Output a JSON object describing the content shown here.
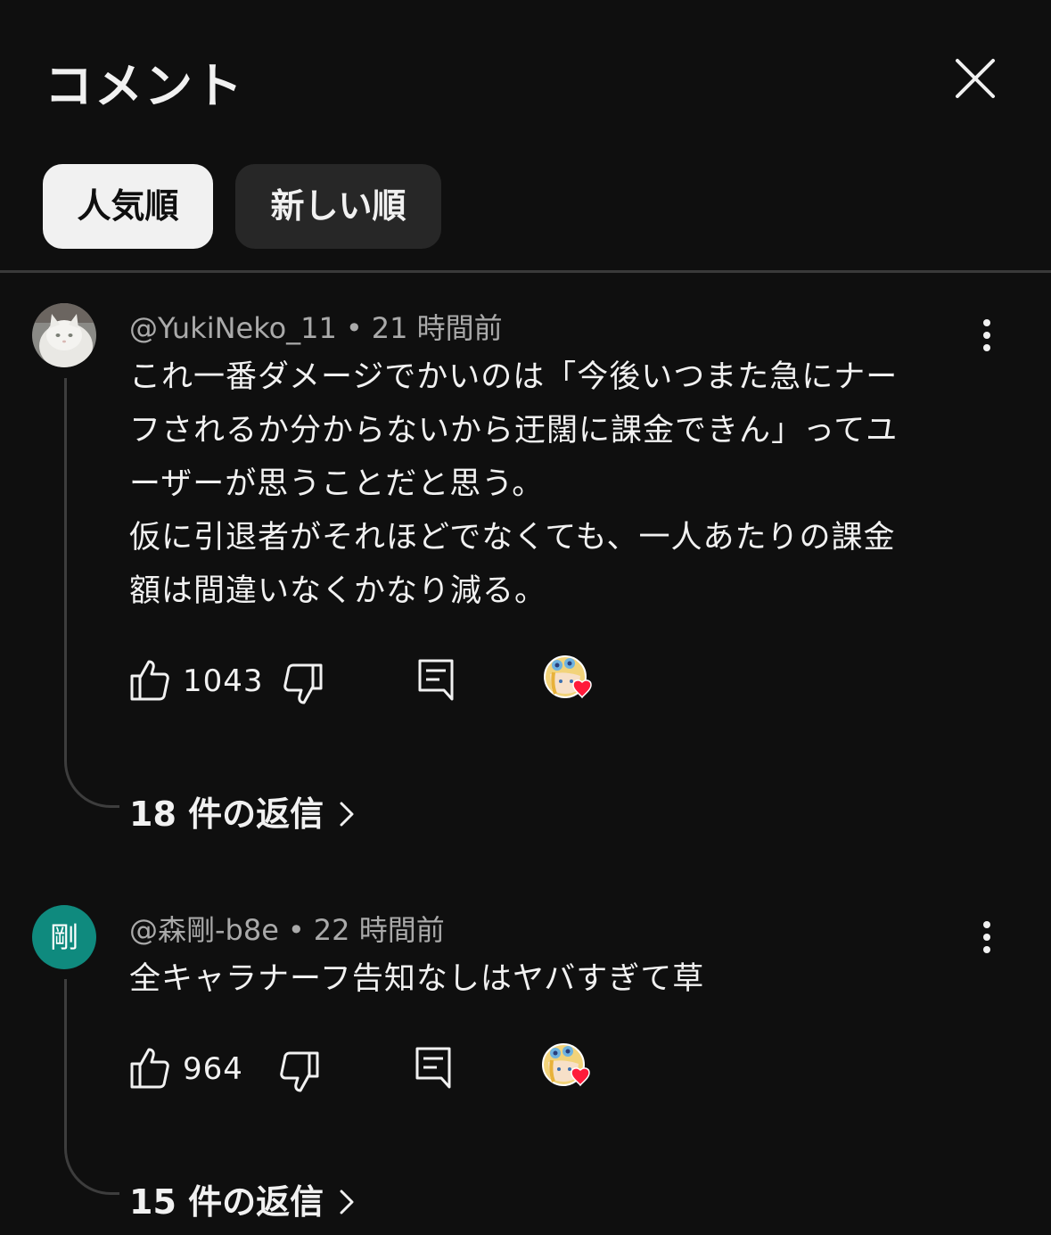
{
  "header": {
    "title": "コメント"
  },
  "sort": {
    "chips": [
      {
        "label": "人気順",
        "active": true
      },
      {
        "label": "新しい順",
        "active": false
      }
    ]
  },
  "comments": [
    {
      "author": "@YukiNeko_11",
      "separator": "•",
      "time": "21 時間前",
      "avatar": "cat-photo",
      "text": "これ一番ダメージでかいのは「今後いつまた急にナー\nフされるか分からないから迂闊に課金できん」ってユ\nーザーが思うことだと思う。\n仮に引退者がそれほどでなくても、一人あたりの課金\n額は間違いなくかなり減る。",
      "likes": "1043",
      "creator_heart": true,
      "replies": "18 件の返信"
    },
    {
      "author": "@森剛-b8e",
      "separator": "•",
      "time": "22 時間前",
      "avatar": "剛",
      "avatar_color": "#0f8a7e",
      "text": "全キャラナーフ告知なしはヤバすぎて草",
      "likes": "964",
      "creator_heart": true,
      "replies": "15 件の返信"
    }
  ],
  "colors": {
    "background": "#0f0f0f",
    "text": "#f1f1f1",
    "secondary": "#aaaaaa",
    "chip_inactive": "#272727",
    "heart": "#ff1a3a"
  }
}
